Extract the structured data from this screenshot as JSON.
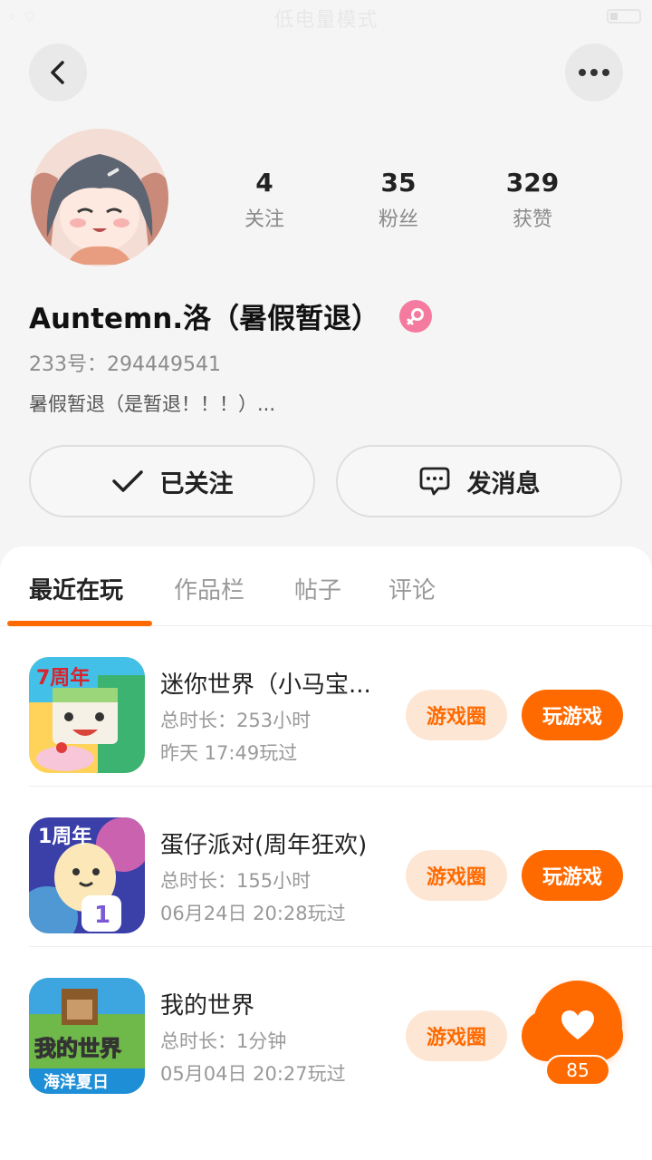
{
  "status_bar": {
    "mode": "低电量模式"
  },
  "profile": {
    "stats": [
      {
        "value": "4",
        "label": "关注"
      },
      {
        "value": "35",
        "label": "粉丝"
      },
      {
        "value": "329",
        "label": "获赞"
      }
    ],
    "username": "Auntemn.洛（暑假暂退）",
    "gender": "female",
    "id_text": "233号：294449541",
    "bio": "暑假暂退（是暂退！！！）..."
  },
  "actions": {
    "follow_label": "已关注",
    "message_label": "发消息"
  },
  "tabs": [
    {
      "label": "最近在玩",
      "active": true
    },
    {
      "label": "作品栏",
      "active": false
    },
    {
      "label": "帖子",
      "active": false
    },
    {
      "label": "评论",
      "active": false
    }
  ],
  "games": [
    {
      "title": "迷你世界（小马宝...",
      "playtime": "总时长：253小时",
      "last_played": "昨天 17:49玩过",
      "circle_label": "游戏圈",
      "play_label": "玩游戏"
    },
    {
      "title": "蛋仔派对(周年狂欢)",
      "playtime": "总时长：155小时",
      "last_played": "06月24日 20:28玩过",
      "circle_label": "游戏圈",
      "play_label": "玩游戏"
    },
    {
      "title": "我的世界",
      "playtime": "总时长：1分钟",
      "last_played": "05月04日 20:27玩过",
      "circle_label": "游戏圈",
      "play_label": "玩游戏"
    }
  ],
  "game_icon_text": {
    "mini_badge": "7周年",
    "party_badge": "1周年",
    "mc_title": "我的世界",
    "mc_subtitle": "海洋夏日"
  },
  "like_float": {
    "count": "85"
  },
  "colors": {
    "accent": "#ff6a00",
    "chip_bg": "#fde6d4",
    "gender_badge": "#f57aa0"
  }
}
